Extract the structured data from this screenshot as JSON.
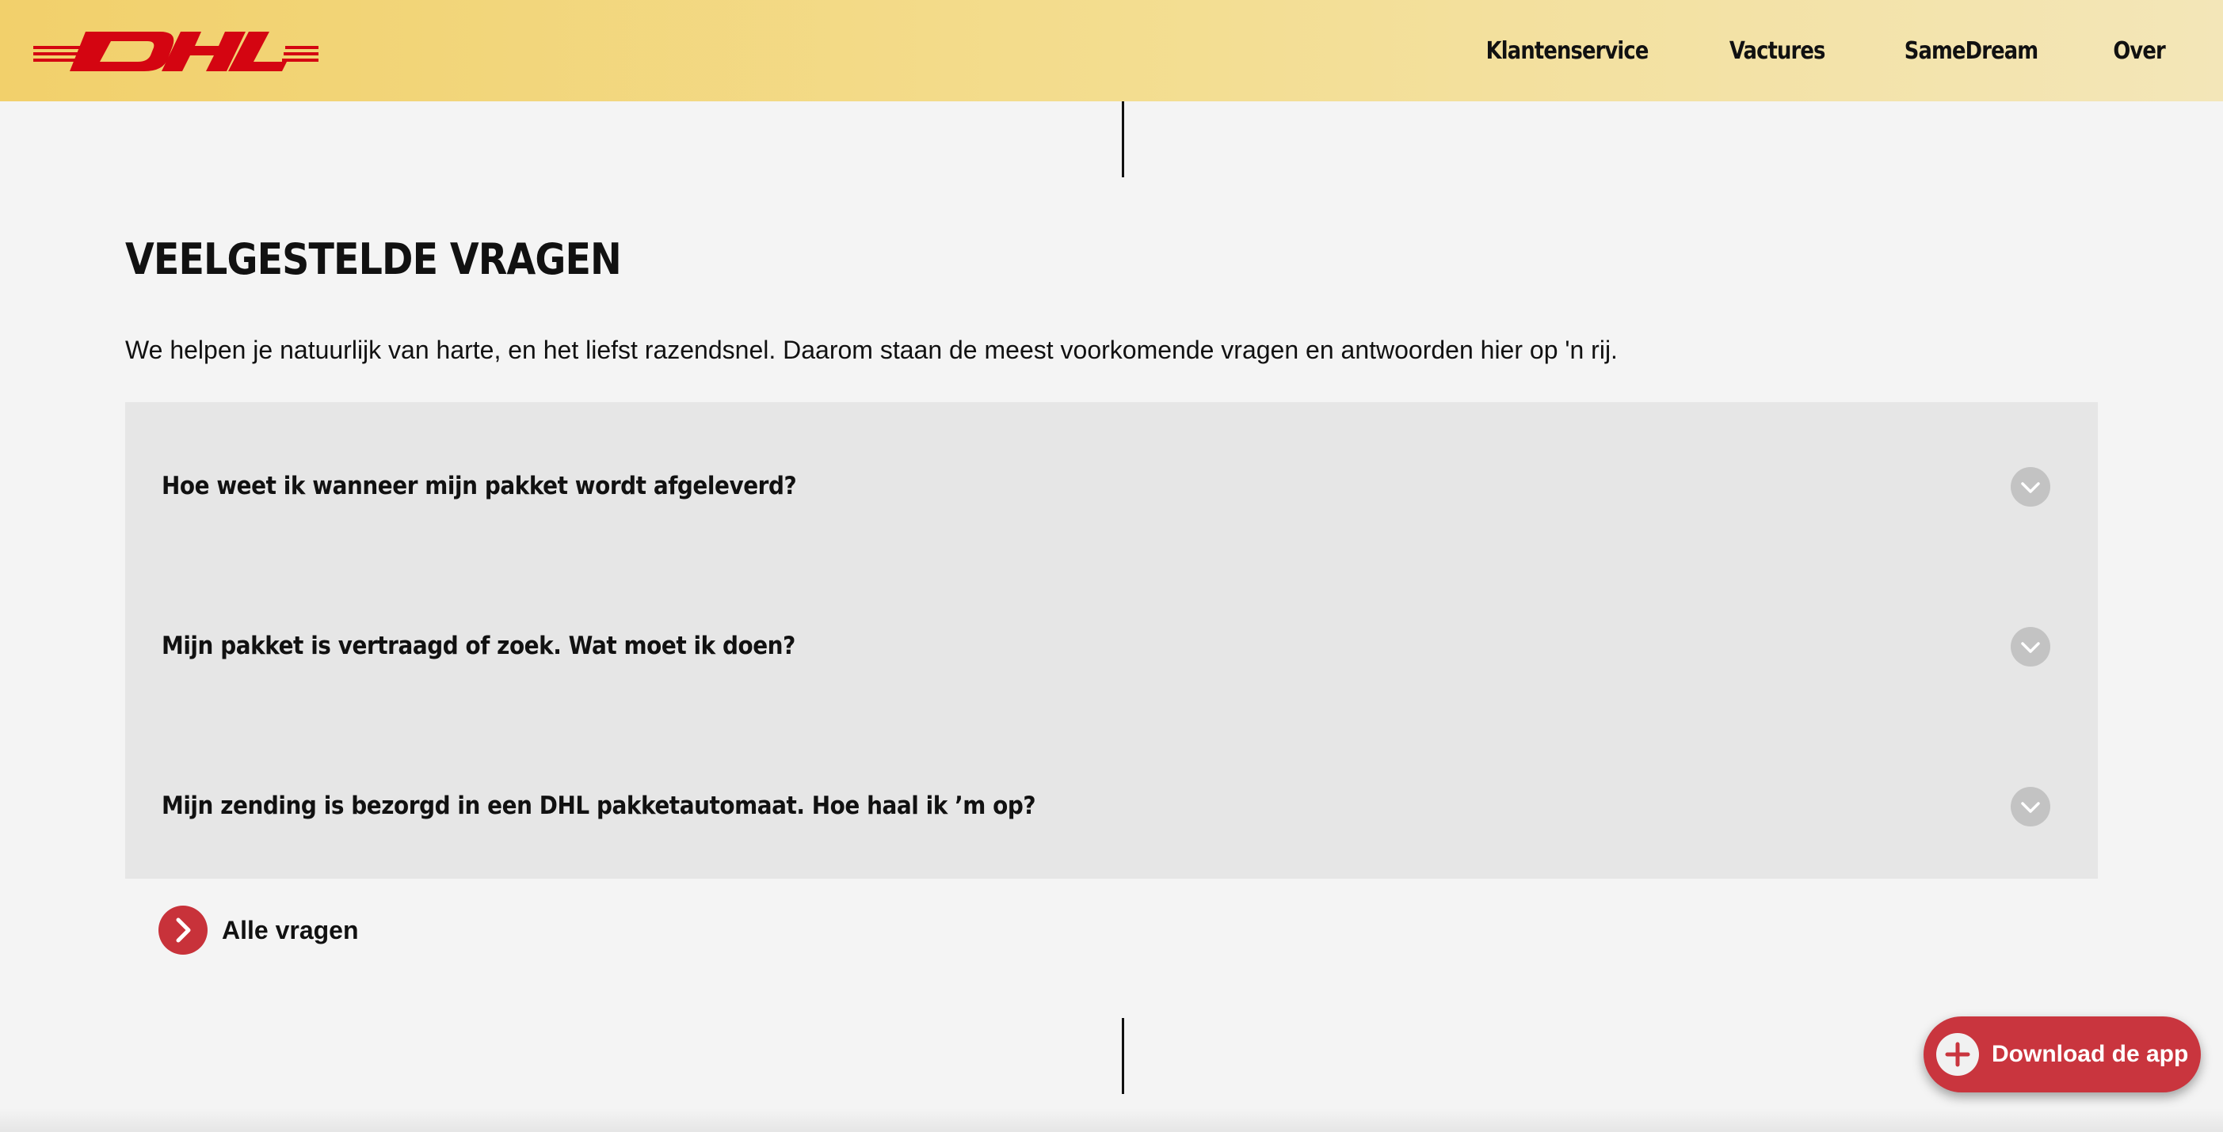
{
  "header": {
    "logo_text": "DHL",
    "nav": [
      "Klantenservice",
      "Vactures",
      "SameDream",
      "Over"
    ]
  },
  "faq": {
    "title": "VEELGESTELDE VRAGEN",
    "intro": "We helpen je natuurlijk van harte, en het liefst razendsnel. Daarom staan de meest voorkomende vragen en antwoorden hier op 'n rij.",
    "items": [
      {
        "question": "Hoe weet ik wanneer mijn pakket wordt afgeleverd?",
        "icon": "chevron-down-icon"
      },
      {
        "question": "Mijn pakket is vertraagd of zoek. Wat moet ik doen?",
        "icon": "chevron-down-icon"
      },
      {
        "question": "Mijn zending is bezorgd in een DHL pakketautomaat. Hoe haal ik ’m op?",
        "icon": "chevron-down-icon"
      }
    ],
    "all_link": {
      "label": "Alle vragen",
      "icon": "chevron-right-icon"
    }
  },
  "app_button": {
    "label": "Download de app",
    "icon": "plus-icon"
  },
  "colors": {
    "brand_red": "#d40511",
    "header_yellow": "#f2d06b",
    "accent_red": "#c9353e",
    "page_bg": "#f4f4f4",
    "faq_bg": "#e6e6e6"
  }
}
